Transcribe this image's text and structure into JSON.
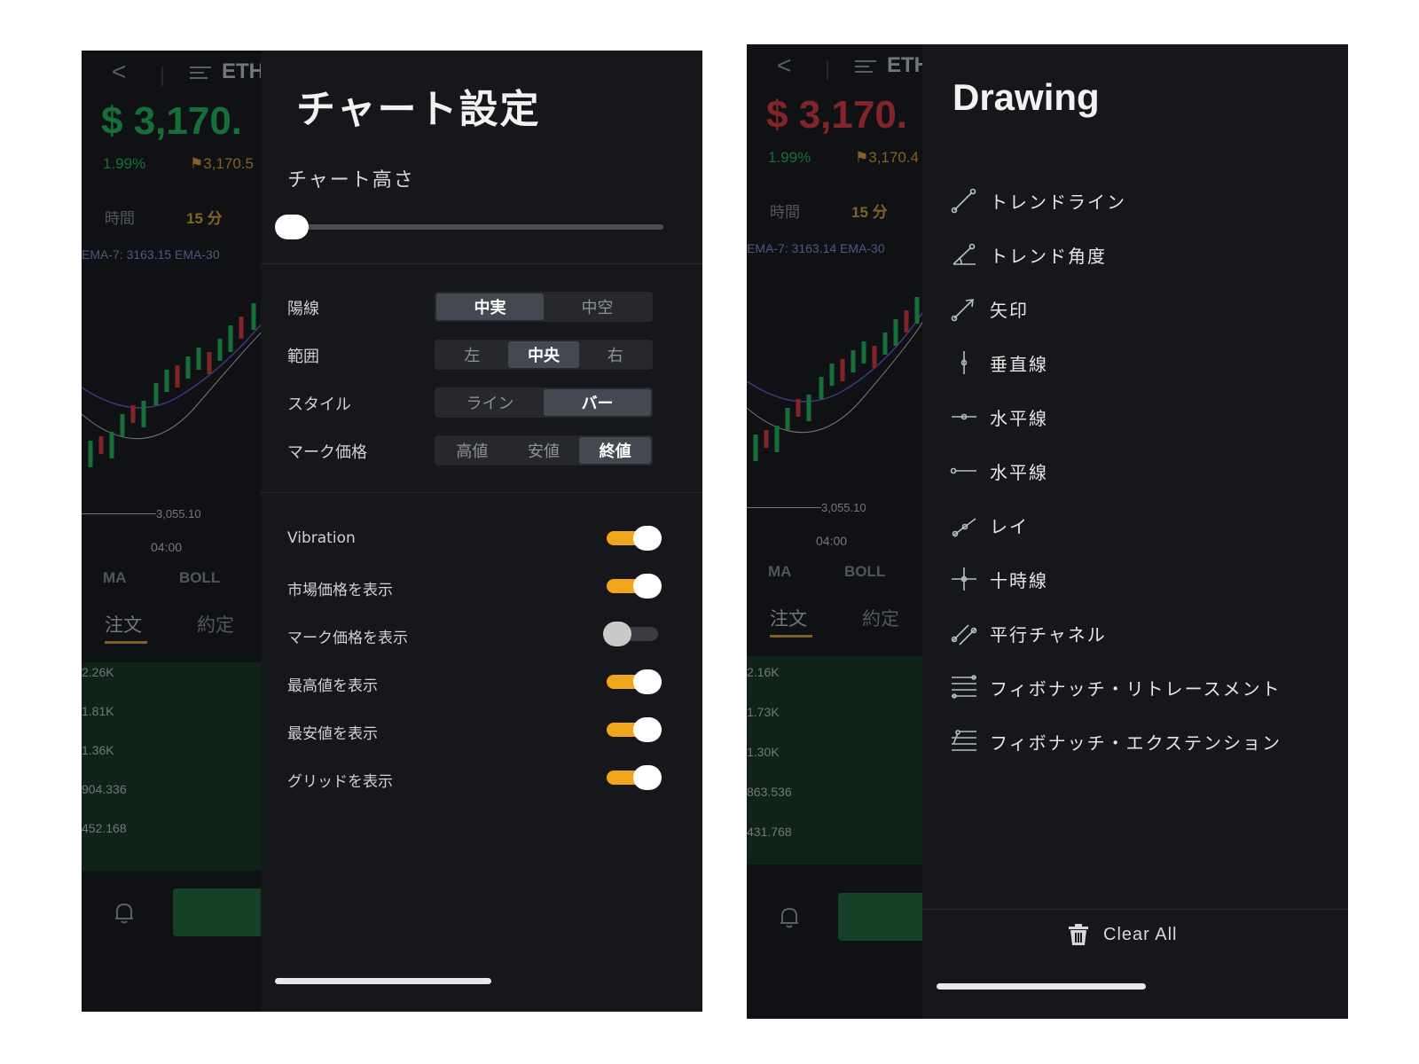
{
  "background_view": {
    "left": {
      "symbol": "ETH",
      "price": "$ 3,170.",
      "price_color": "#1fbf5c",
      "change_pct": "1.99%",
      "mark_price": "3,170.5",
      "time_label": "時間",
      "time_value": "15 分",
      "ema_text": "EMA-7: 3163.15  EMA-30",
      "level": "3,055.10",
      "hour": "04:00",
      "indicators": [
        "MA",
        "BOLL"
      ],
      "order_tabs": [
        "注文",
        "約定"
      ],
      "depth_values": [
        "2.26K",
        "1.81K",
        "1.36K",
        "904.336",
        "452.168"
      ]
    },
    "right": {
      "symbol": "ETH",
      "price": "$ 3,170.",
      "price_color": "#e0383e",
      "change_pct": "1.99%",
      "mark_price": "3,170.4",
      "time_label": "時間",
      "time_value": "15 分",
      "ema_text": "EMA-7: 3163.14  EMA-30",
      "level": "3,055.10",
      "hour": "04:00",
      "indicators": [
        "MA",
        "BOLL"
      ],
      "order_tabs": [
        "注文",
        "約定"
      ],
      "depth_values": [
        "2.16K",
        "1.73K",
        "1.30K",
        "863.536",
        "431.768"
      ]
    }
  },
  "chart_settings": {
    "title": "チャート設定",
    "height_label": "チャート高さ",
    "height_value": 0,
    "rows": [
      {
        "label": "陽線",
        "options": [
          "中実",
          "中空"
        ],
        "selected": 0
      },
      {
        "label": "範囲",
        "options": [
          "左",
          "中央",
          "右"
        ],
        "selected": 1
      },
      {
        "label": "スタイル",
        "options": [
          "ライン",
          "バー"
        ],
        "selected": 1
      },
      {
        "label": "マーク価格",
        "options": [
          "高値",
          "安値",
          "終値"
        ],
        "selected": 2
      }
    ],
    "toggles": [
      {
        "label": "Vibration",
        "on": true
      },
      {
        "label": "市場価格を表示",
        "on": true
      },
      {
        "label": "マーク価格を表示",
        "on": false
      },
      {
        "label": "最高値を表示",
        "on": true
      },
      {
        "label": "最安値を表示",
        "on": true
      },
      {
        "label": "グリッドを表示",
        "on": true
      }
    ],
    "toggle_on_color": "#f0a51a"
  },
  "drawing": {
    "title": "Drawing",
    "tools": [
      {
        "label": "トレンドライン",
        "icon": "trend-line-icon"
      },
      {
        "label": "トレンド角度",
        "icon": "trend-angle-icon"
      },
      {
        "label": "矢印",
        "icon": "arrow-icon"
      },
      {
        "label": "垂直線",
        "icon": "vertical-line-icon"
      },
      {
        "label": "水平線",
        "icon": "horizontal-line-icon"
      },
      {
        "label": "水平線",
        "icon": "horizontal-ray-icon"
      },
      {
        "label": "レイ",
        "icon": "ray-icon"
      },
      {
        "label": "十時線",
        "icon": "crosshair-icon"
      },
      {
        "label": "平行チャネル",
        "icon": "parallel-channel-icon"
      },
      {
        "label": "フィボナッチ・リトレースメント",
        "icon": "fib-retracement-icon"
      },
      {
        "label": "フィボナッチ・エクステンション",
        "icon": "fib-extension-icon"
      }
    ],
    "clear_label": "Clear All"
  }
}
